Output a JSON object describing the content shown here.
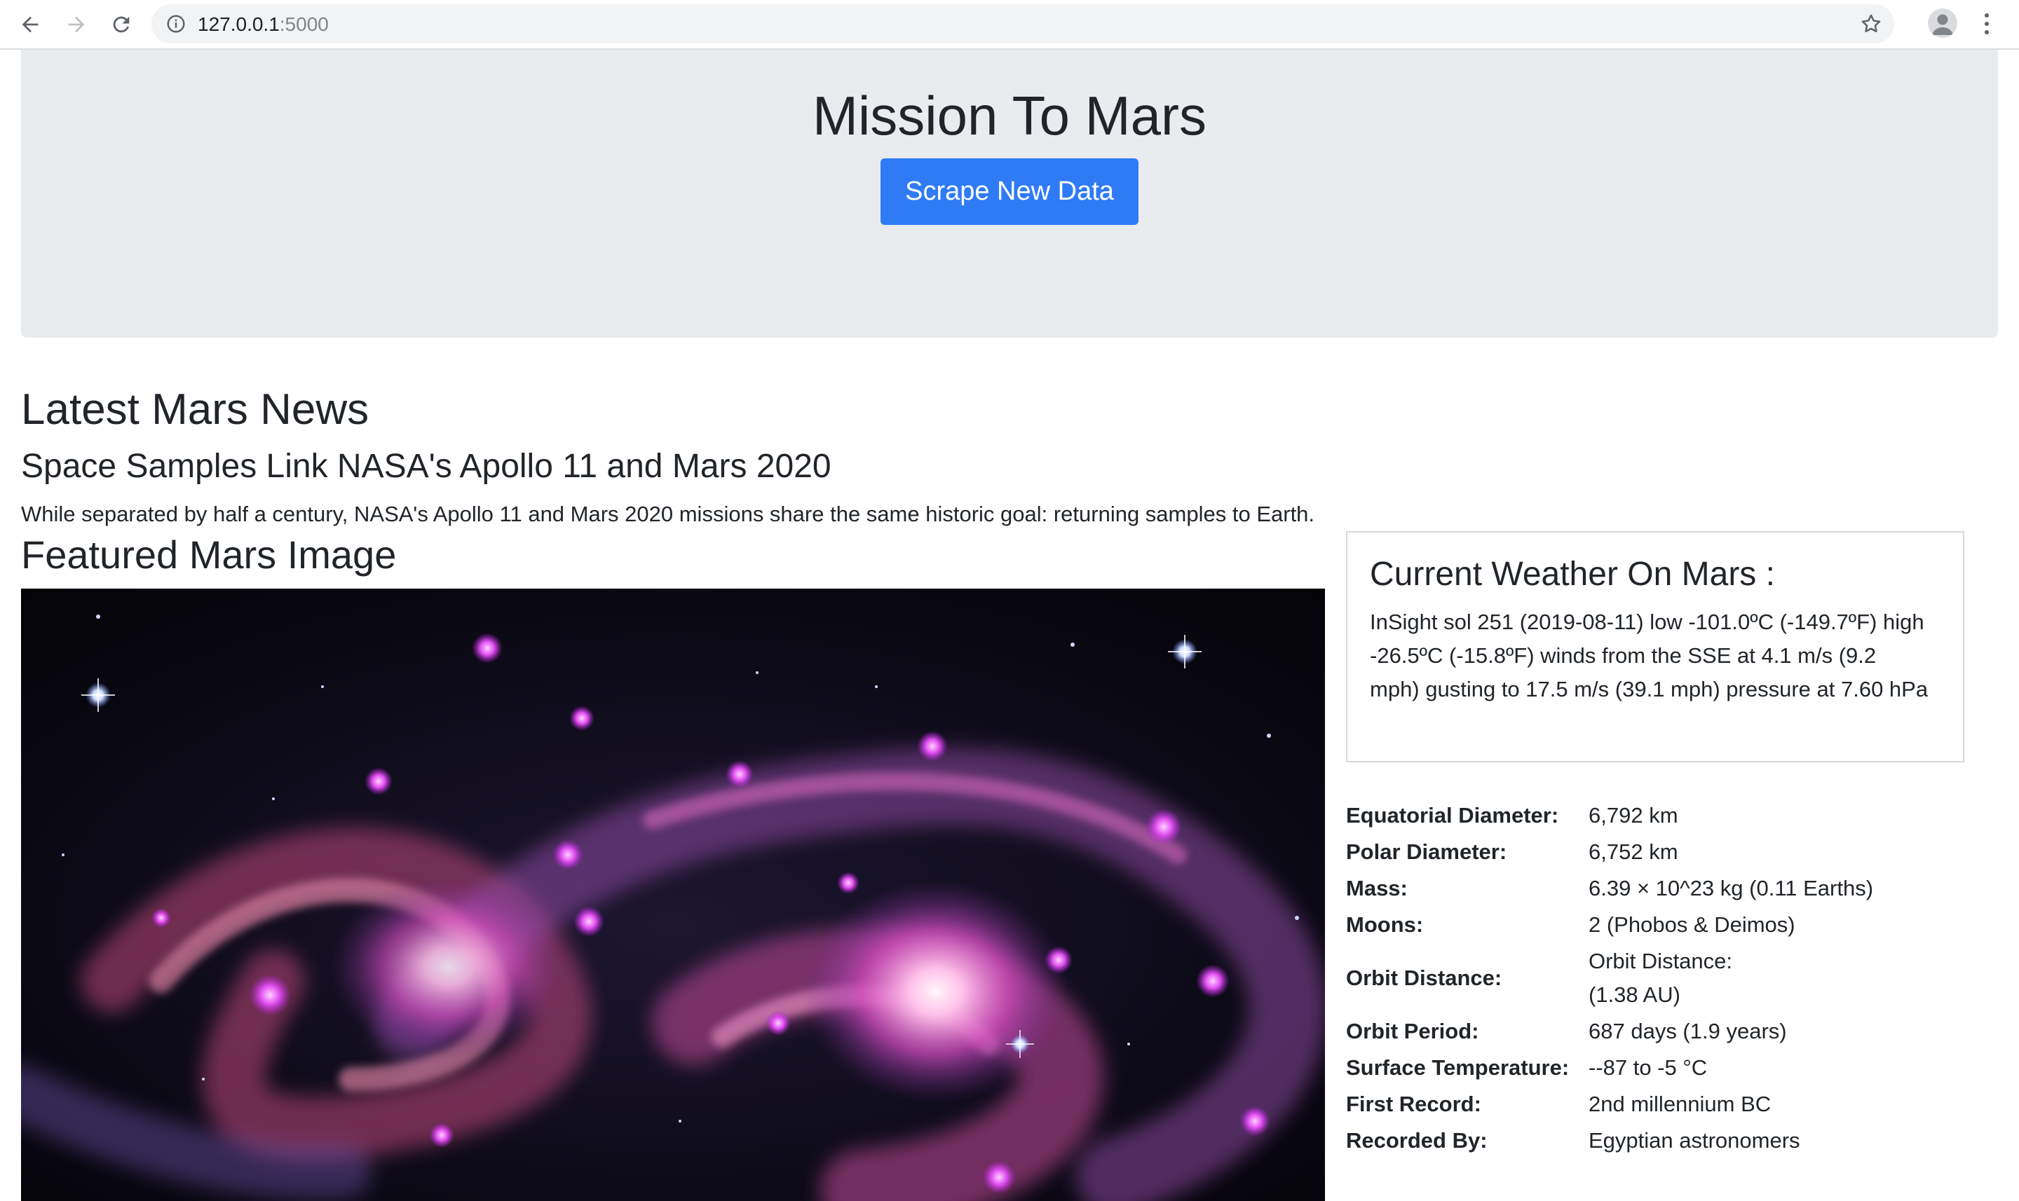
{
  "browser": {
    "url_host": "127.0.0.1",
    "url_port": ":5000"
  },
  "header": {
    "title": "Mission To Mars",
    "scrape_button": "Scrape New Data"
  },
  "news": {
    "section_heading": "Latest Mars News",
    "title": "Space Samples Link NASA's Apollo 11 and Mars 2020",
    "paragraph": "While separated by half a century, NASA's Apollo 11 and Mars 2020 missions share the same historic goal: returning samples to Earth."
  },
  "featured_image": {
    "heading": "Featured Mars Image"
  },
  "weather": {
    "heading": "Current Weather On Mars :",
    "text": "InSight sol 251 (2019-08-11) low -101.0ºC (-149.7ºF) high -26.5ºC (-15.8ºF) winds from the SSE at 4.1 m/s (9.2 mph) gusting to 17.5 m/s (39.1 mph) pressure at 7.60 hPa"
  },
  "facts": [
    {
      "label": "Equatorial Diameter:",
      "value": "6,792 km"
    },
    {
      "label": "Polar Diameter:",
      "value": "6,752 km"
    },
    {
      "label": "Mass:",
      "value": "6.39 × 10^23 kg (0.11 Earths)"
    },
    {
      "label": "Moons:",
      "value": "2 (Phobos & Deimos)"
    },
    {
      "label": "Orbit Distance:",
      "value": "Orbit Distance:",
      "value2": "(1.38 AU)"
    },
    {
      "label": "Orbit Period:",
      "value": "687 days (1.9 years)"
    },
    {
      "label": "Surface Temperature:",
      "value": "--87 to -5 °C"
    },
    {
      "label": "First Record:",
      "value": "2nd millennium BC"
    },
    {
      "label": "Recorded By:",
      "value": "Egyptian astronomers"
    }
  ],
  "colors": {
    "primary_button": "#2f7bf6",
    "jumbotron_bg": "#e9ecef"
  }
}
